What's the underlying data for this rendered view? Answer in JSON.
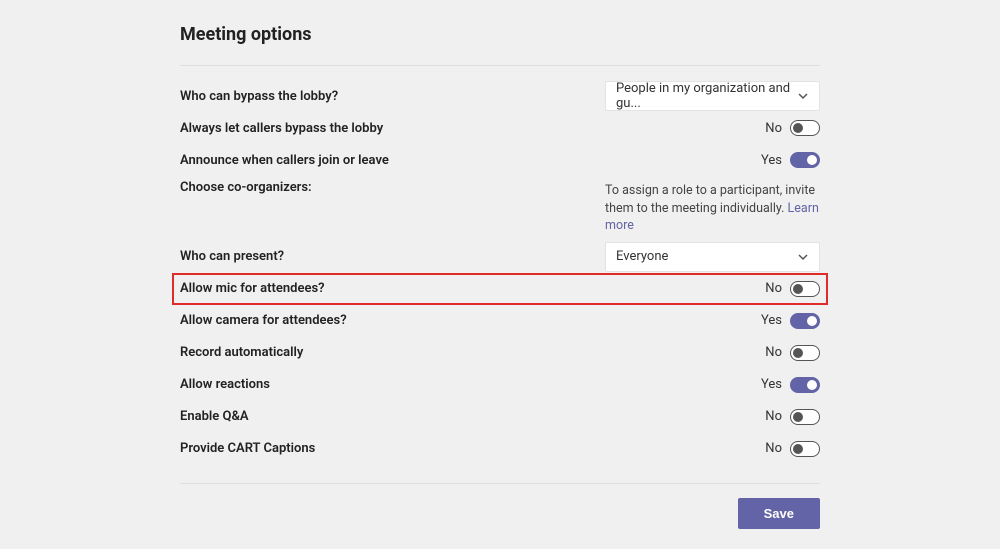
{
  "title": "Meeting options",
  "options": {
    "bypass_lobby": {
      "label": "Who can bypass the lobby?",
      "value": "People in my organization and gu..."
    },
    "always_bypass": {
      "label": "Always let callers bypass the lobby",
      "state": "No",
      "on": false
    },
    "announce": {
      "label": "Announce when callers join or leave",
      "state": "Yes",
      "on": true
    },
    "coorganizers": {
      "label": "Choose co-organizers:",
      "info_prefix": "To assign a role to a participant, invite them to the meeting individually. ",
      "info_link": "Learn more"
    },
    "presenters": {
      "label": "Who can present?",
      "value": "Everyone"
    },
    "allow_mic": {
      "label": "Allow mic for attendees?",
      "state": "No",
      "on": false
    },
    "allow_camera": {
      "label": "Allow camera for attendees?",
      "state": "Yes",
      "on": true
    },
    "record_auto": {
      "label": "Record automatically",
      "state": "No",
      "on": false
    },
    "allow_reactions": {
      "label": "Allow reactions",
      "state": "Yes",
      "on": true
    },
    "enable_qa": {
      "label": "Enable Q&A",
      "state": "No",
      "on": false
    },
    "cart": {
      "label": "Provide CART Captions",
      "state": "No",
      "on": false
    }
  },
  "save_label": "Save"
}
